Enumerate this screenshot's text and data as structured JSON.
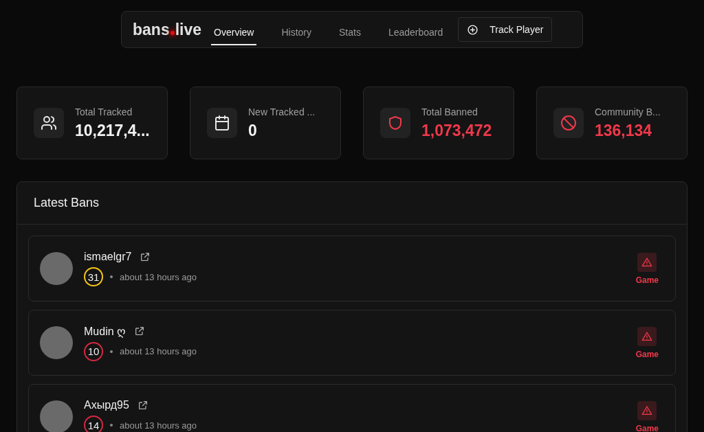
{
  "nav": {
    "logo_left": "bans",
    "logo_right": "live",
    "tabs": [
      {
        "label": "Overview",
        "selected": true
      },
      {
        "label": "History",
        "selected": false
      },
      {
        "label": "Stats",
        "selected": false
      },
      {
        "label": "Leaderboard",
        "selected": false
      }
    ],
    "button": "Track Player"
  },
  "stats": [
    {
      "kind": "users",
      "label": "Total Tracked",
      "value": "10,217,4...",
      "color": "#f2f2f2"
    },
    {
      "kind": "calendar",
      "label": "New Tracked ...",
      "value": "0",
      "color": "#f2f2f2"
    },
    {
      "kind": "shield",
      "label": "Total Banned",
      "value": "1,073,472",
      "color": "#f0384a"
    },
    {
      "kind": "ban",
      "label": "Community B...",
      "value": "136,134",
      "color": "#f0384a"
    }
  ],
  "latest_bans": {
    "title": "Latest Bans",
    "items": [
      {
        "name": "ismaelgr7",
        "level": "31",
        "color": "#f5c518",
        "time": "about 13 hours ago",
        "ban_type": "Game"
      },
      {
        "name": "Mudin ღ",
        "level": "10",
        "color": "#d4283f",
        "time": "about 13 hours ago",
        "ban_type": "Game"
      },
      {
        "name": "Ахырд95",
        "level": "14",
        "color": "#d4283f",
        "time": "about 13 hours ago",
        "ban_type": "Game"
      }
    ]
  }
}
